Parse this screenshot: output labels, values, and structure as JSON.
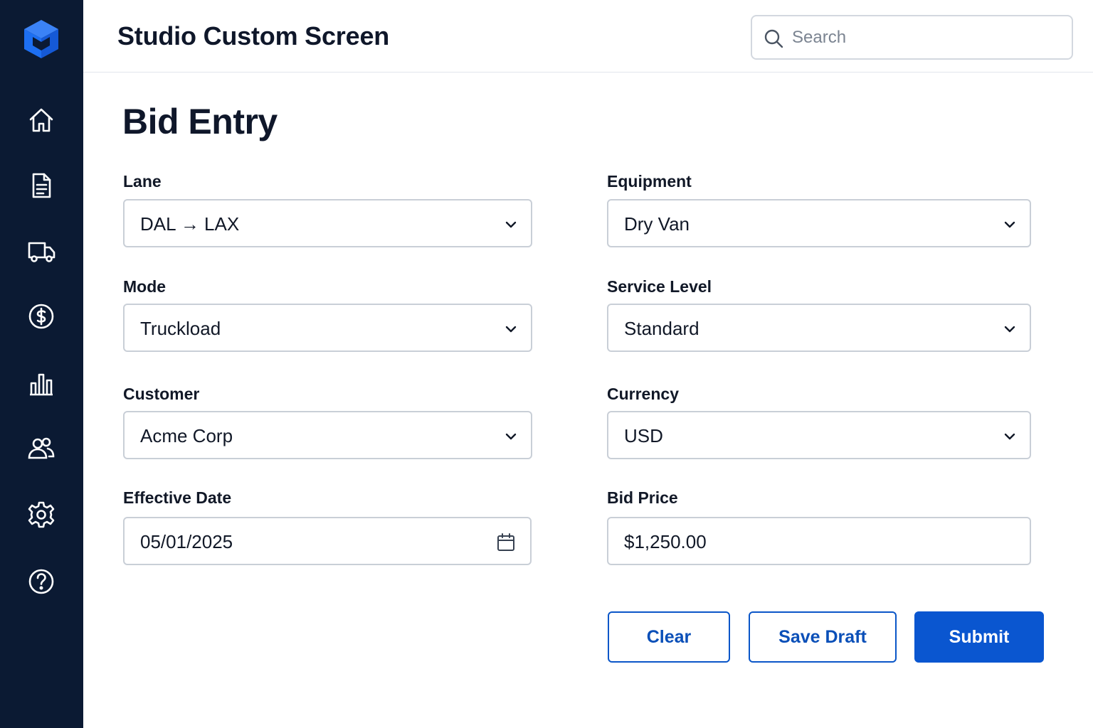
{
  "header": {
    "title": "Studio Custom Screen",
    "search_placeholder": "Search"
  },
  "sidebar": {
    "items": [
      {
        "id": "home",
        "icon": "home-icon"
      },
      {
        "id": "documents",
        "icon": "document-icon"
      },
      {
        "id": "shipments",
        "icon": "truck-icon"
      },
      {
        "id": "billing",
        "icon": "dollar-icon"
      },
      {
        "id": "analytics",
        "icon": "bar-chart-icon"
      },
      {
        "id": "users",
        "icon": "users-icon"
      },
      {
        "id": "settings",
        "icon": "gear-icon"
      },
      {
        "id": "help",
        "icon": "help-icon"
      }
    ]
  },
  "page": {
    "title": "Bid Entry"
  },
  "form": {
    "lane": {
      "label": "Lane",
      "value": "DAL → LAX"
    },
    "equipment": {
      "label": "Equipment",
      "value": "Dry Van"
    },
    "mode": {
      "label": "Mode",
      "value": "Truckload"
    },
    "service_level": {
      "label": "Service Level",
      "value": "Standard"
    },
    "customer": {
      "label": "Customer",
      "value": "Acme Corp"
    },
    "currency": {
      "label": "Currency",
      "value": "USD"
    },
    "effective_date": {
      "label": "Effective Date",
      "value": "05/01/2025"
    },
    "bid_price": {
      "label": "Bid Price",
      "value": "$1,250.00"
    }
  },
  "actions": {
    "clear_label": "Clear",
    "save_draft_label": "Save Draft",
    "submit_label": "Submit"
  },
  "colors": {
    "sidebar_bg": "#0b1a33",
    "accent": "#0a56d0",
    "logo_blue": "#1f6feb"
  }
}
